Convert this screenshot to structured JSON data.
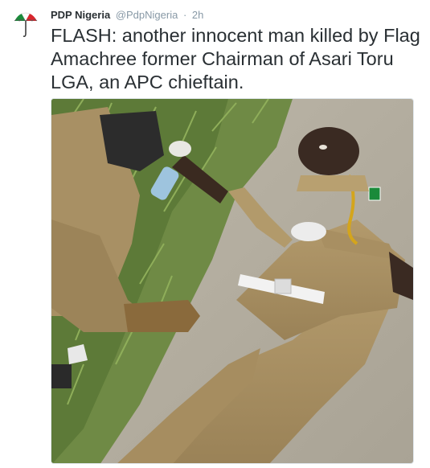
{
  "tweet": {
    "display_name": "PDP Nigeria",
    "handle": "@PdpNigeria",
    "separator": "·",
    "time": "2h",
    "text": "FLASH: another innocent man killed by Flag Amachree former Chairman of Asari Toru LGA, an APC chieftain.",
    "avatar_icon": "umbrella-logo-icon",
    "photo_subject": "photo-man-lying-on-ground"
  },
  "colors": {
    "name": "#292f33",
    "meta": "#8899a6",
    "umbrella_red": "#d8262d",
    "umbrella_green": "#1a8a3a"
  }
}
